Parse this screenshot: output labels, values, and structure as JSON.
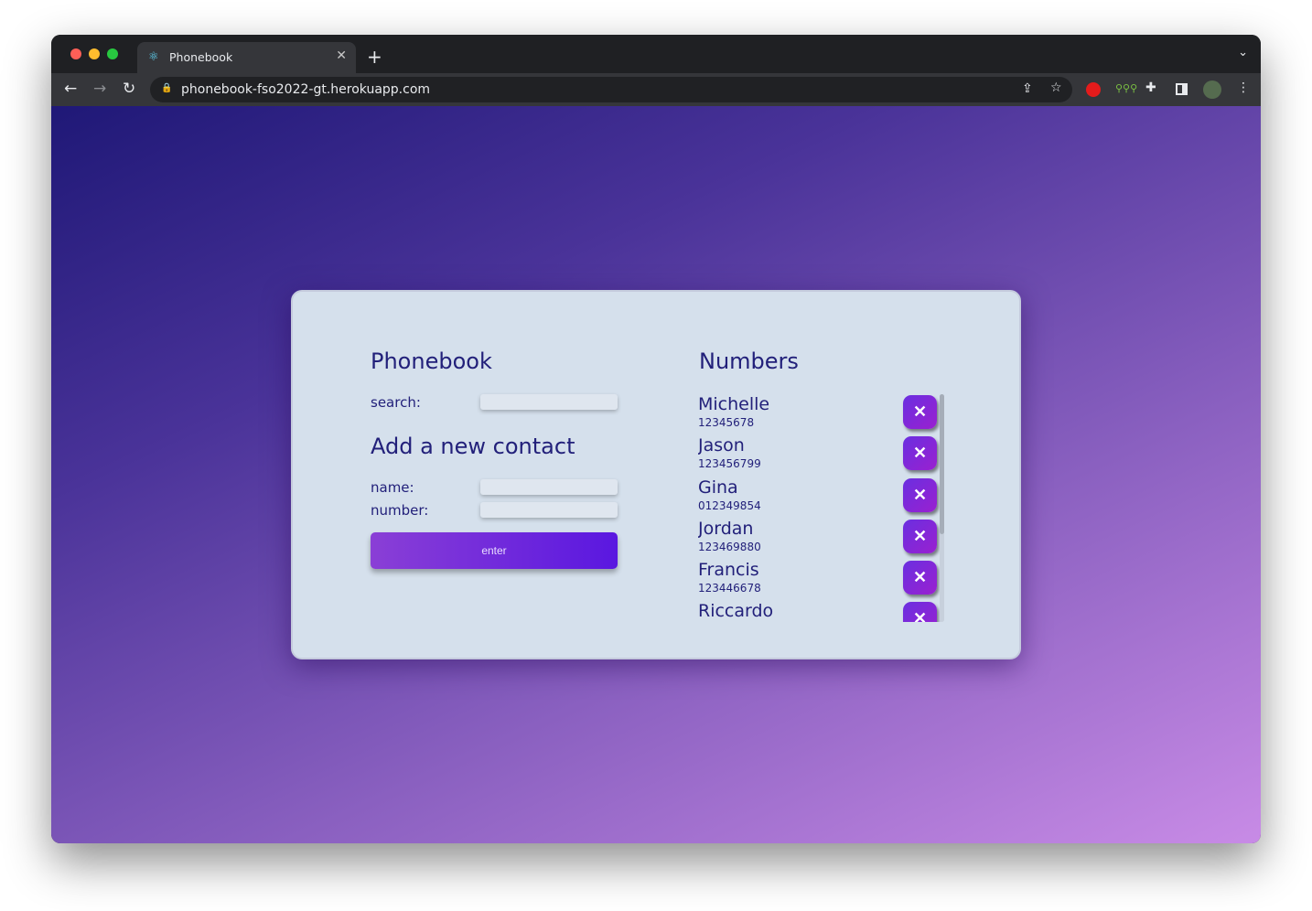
{
  "browser": {
    "tab_title": "Phonebook",
    "url": "phonebook-fso2022-gt.herokuapp.com"
  },
  "app": {
    "title": "Phonebook",
    "search_label": "search:",
    "search_value": "",
    "add_title": "Add a new contact",
    "name_label": "name:",
    "name_value": "",
    "number_label": "number:",
    "number_value": "",
    "enter_label": "enter",
    "numbers_title": "Numbers",
    "delete_glyph": "✕",
    "scroll_position": 0,
    "contacts": [
      {
        "name": "Michelle",
        "number": "12345678"
      },
      {
        "name": "Jason",
        "number": "123456799"
      },
      {
        "name": "Gina",
        "number": "012349854"
      },
      {
        "name": "Jordan",
        "number": "123469880"
      },
      {
        "name": "Francis",
        "number": "123446678"
      },
      {
        "name": "Riccardo",
        "number": ""
      }
    ]
  },
  "colors": {
    "accent": "#6a2fe0",
    "text": "#22207a",
    "card": "#d5e0ec"
  }
}
